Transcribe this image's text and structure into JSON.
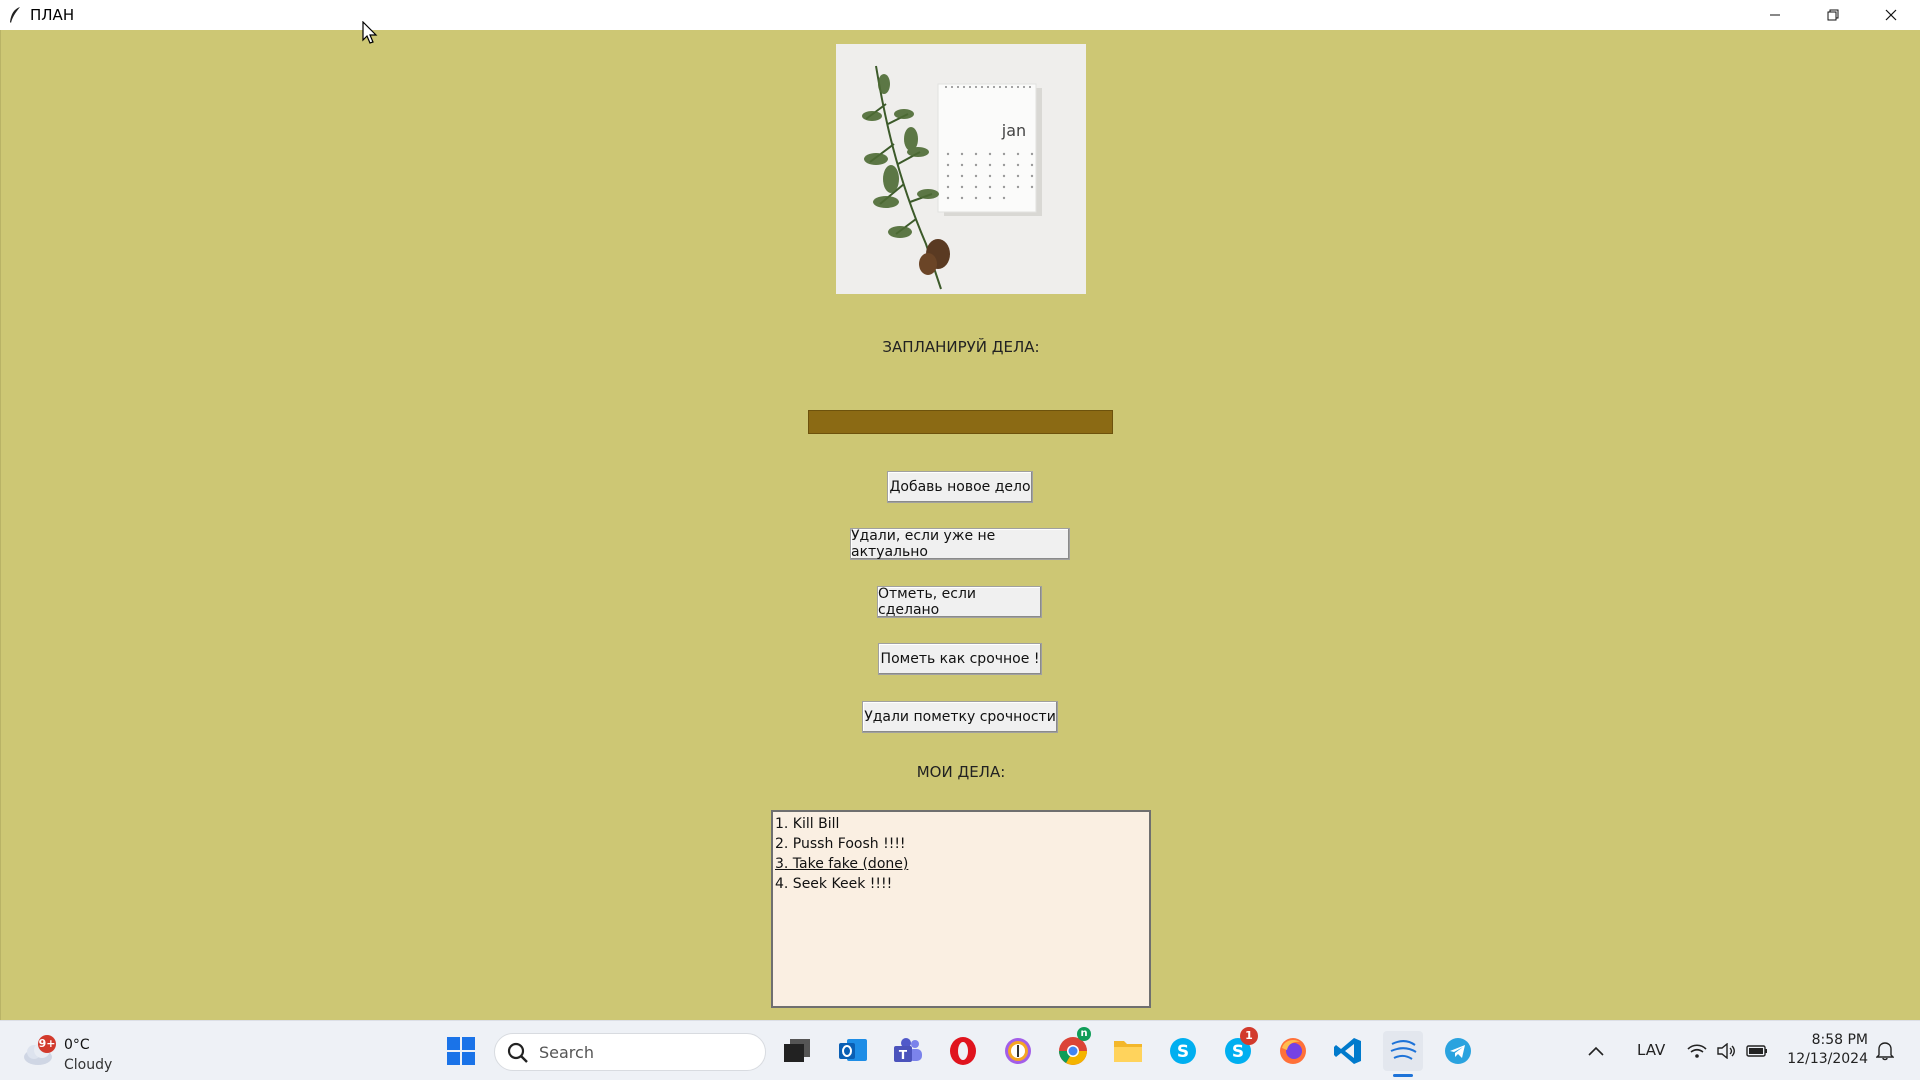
{
  "window": {
    "title": "ПЛАН"
  },
  "app": {
    "heading": "ЗАПЛАНИРУЙ ДЕЛА:",
    "task_input_value": "",
    "buttons": {
      "add": "Добавь новое дело",
      "delete": "Удали, если уже не актуально",
      "mark_done": "Отметь, если сделано",
      "mark_urgent": "Пометь как срочное !",
      "unmark_urgent": "Удали пометку срочности"
    },
    "list_heading": "МОИ ДЕЛА:",
    "tasks": [
      "1. Kill Bill",
      "2. Pussh Foosh !!!!",
      "3. Take fake (done)",
      "4. Seek Keek !!!!"
    ],
    "photo_text": "jan"
  },
  "taskbar": {
    "weather": {
      "temp": "0°C",
      "desc": "Cloudy",
      "badge": "9+"
    },
    "search_placeholder": "Search",
    "skype_badge": "1",
    "chrome_badge": "n",
    "language": "LAV",
    "time": "8:58 PM",
    "date": "12/13/2024"
  },
  "colors": {
    "app_background": "#cdc774",
    "entry_background": "#8b6a14",
    "listbox_background": "#faefe2"
  }
}
